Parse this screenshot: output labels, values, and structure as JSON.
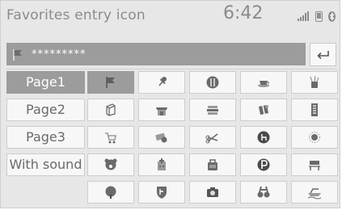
{
  "header": {
    "title": "Favorites entry icon",
    "time": "6:42"
  },
  "status": {
    "signal": "signal-bars-icon",
    "phone": "phone-icon",
    "bluetooth": "bluetooth-icon"
  },
  "entry": {
    "value": "*********",
    "icon": "flag-icon",
    "back_icon": "return-arrow-icon"
  },
  "colors": {
    "accent": "#9c9c9c",
    "background": "#e7e7e7",
    "button": "#f7f7f7",
    "text": "#6a6a6a"
  },
  "pages": [
    {
      "label": "Page1",
      "selected": true
    },
    {
      "label": "Page2",
      "selected": false
    },
    {
      "label": "Page3",
      "selected": false
    },
    {
      "label": "With sound",
      "selected": false
    }
  ],
  "icon_grid": [
    [
      "flag-icon",
      "pin-icon",
      "restaurant-icon",
      "coffee-cup-icon",
      "pen-cup-icon"
    ],
    [
      "cube-icon",
      "shop-icon",
      "stacked-books-icon",
      "gift-icon",
      "building-icon"
    ],
    [
      "shopping-cart-icon",
      "money-icon",
      "scissors-icon",
      "hotel-icon",
      "sun-icon"
    ],
    [
      "animal-icon",
      "hospital-icon",
      "bag-icon",
      "parking-icon",
      "bench-icon"
    ],
    [
      "tree-icon",
      "shield-icon",
      "camera-icon",
      "binoculars-icon",
      "ship-icon"
    ]
  ],
  "selected_icon": "flag-icon"
}
